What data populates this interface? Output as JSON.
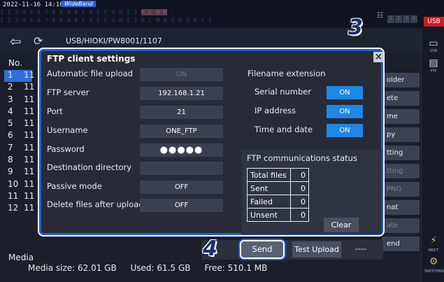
{
  "topbar": {
    "timestamp": "2022-11-16 14:16:37",
    "mode_badge": "WideBand",
    "usb_tag": "USB",
    "net_slots": [
      "1",
      "2",
      "3",
      "4",
      "5",
      "6",
      "7",
      "8"
    ]
  },
  "path": "USB/HIOKI/PW8001/1107",
  "callouts": {
    "step3": "3",
    "step4": "4"
  },
  "file_list": {
    "header": "No.",
    "rows": [
      {
        "no": "1",
        "text": "11"
      },
      {
        "no": "2",
        "text": "11"
      },
      {
        "no": "3",
        "text": "11"
      },
      {
        "no": "4",
        "text": "11"
      },
      {
        "no": "5",
        "text": "11"
      },
      {
        "no": "6",
        "text": "11"
      },
      {
        "no": "7",
        "text": "11"
      },
      {
        "no": "8",
        "text": "11"
      },
      {
        "no": "9",
        "text": "11"
      },
      {
        "no": "10",
        "text": "11"
      },
      {
        "no": "11",
        "text": "11"
      },
      {
        "no": "12",
        "text": "11"
      }
    ],
    "selected_index": 0
  },
  "side_buttons": [
    {
      "label": "older",
      "enabled": true
    },
    {
      "label": "ete",
      "enabled": true
    },
    {
      "label": "me",
      "enabled": true
    },
    {
      "label": "py",
      "enabled": true
    },
    {
      "label": "tting",
      "enabled": true
    },
    {
      "label": "tting",
      "enabled": false
    },
    {
      "label": "PNG",
      "enabled": false
    },
    {
      "label": "nat",
      "enabled": true
    },
    {
      "label": "ate",
      "enabled": false
    },
    {
      "label": "end",
      "enabled": true
    }
  ],
  "right_strip": {
    "item1": "USB",
    "item2": "FTP",
    "item3": "KWCT",
    "item4": "SWITCHING"
  },
  "media": {
    "label": "Media",
    "size": "Media size: 62.01 GB",
    "used": "Used: 61.5 GB",
    "free": "Free: 510.1 MB"
  },
  "dialog": {
    "title": "FTP client settings",
    "close": "×",
    "settings": [
      {
        "label": "Automatic file upload",
        "value": "ON",
        "enabled": false
      },
      {
        "label": "FTP server",
        "value": "192.168.1.21",
        "enabled": true
      },
      {
        "label": "Port",
        "value": "21",
        "enabled": true
      },
      {
        "label": "Username",
        "value": "ONE_FTP",
        "enabled": true
      },
      {
        "label": "Password",
        "value": "●●●●●",
        "enabled": true
      },
      {
        "label": "Destination directory",
        "value": "",
        "enabled": true
      },
      {
        "label": "Passive mode",
        "value": "OFF",
        "enabled": true
      },
      {
        "label": "Delete files after upload",
        "value": "OFF",
        "enabled": true
      }
    ],
    "filename_extension": {
      "title": "Filename extension",
      "items": [
        {
          "label": "Serial number",
          "value": "ON"
        },
        {
          "label": "IP address",
          "value": "ON"
        },
        {
          "label": "Time and date",
          "value": "ON"
        }
      ]
    },
    "status": {
      "title": "FTP communications status",
      "rows": [
        {
          "label": "Total files",
          "value": "0"
        },
        {
          "label": "Sent",
          "value": "0"
        },
        {
          "label": "Failed",
          "value": "0"
        },
        {
          "label": "Unsent",
          "value": "0"
        }
      ],
      "clear_label": "Clear"
    },
    "send_label": "Send",
    "test_upload_label": "Test Upload",
    "status_placeholder": "----"
  }
}
